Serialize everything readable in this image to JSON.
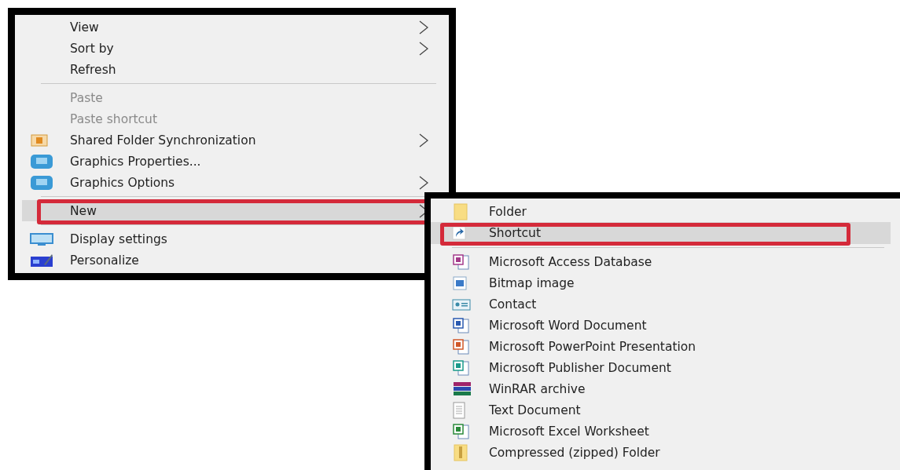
{
  "context_menu": {
    "items": [
      {
        "kind": "item",
        "label": "View",
        "disabled": false,
        "submenu": true,
        "selected": false
      },
      {
        "kind": "item",
        "label": "Sort by",
        "disabled": false,
        "submenu": true,
        "selected": false
      },
      {
        "kind": "item",
        "label": "Refresh",
        "disabled": false,
        "submenu": false,
        "selected": false
      },
      {
        "kind": "separator"
      },
      {
        "kind": "item",
        "label": "Paste",
        "disabled": true,
        "submenu": false,
        "selected": false
      },
      {
        "kind": "item",
        "label": "Paste shortcut",
        "disabled": true,
        "submenu": false,
        "selected": false
      },
      {
        "kind": "item",
        "label": "Shared Folder Synchronization",
        "disabled": false,
        "submenu": true,
        "selected": false
      },
      {
        "kind": "item",
        "label": "Graphics Properties...",
        "disabled": false,
        "submenu": false,
        "selected": false
      },
      {
        "kind": "item",
        "label": "Graphics Options",
        "disabled": false,
        "submenu": true,
        "selected": false
      },
      {
        "kind": "separator"
      },
      {
        "kind": "item",
        "label": "New",
        "disabled": false,
        "submenu": true,
        "selected": true
      },
      {
        "kind": "separator"
      },
      {
        "kind": "item",
        "label": "Display settings",
        "disabled": false,
        "submenu": false,
        "selected": false
      },
      {
        "kind": "item",
        "label": "Personalize",
        "disabled": false,
        "submenu": false,
        "selected": false
      }
    ]
  },
  "new_submenu": {
    "items": [
      {
        "kind": "item",
        "label": "Folder",
        "selected": false
      },
      {
        "kind": "item",
        "label": "Shortcut",
        "selected": true
      },
      {
        "kind": "separator"
      },
      {
        "kind": "item",
        "label": "Microsoft Access Database",
        "selected": false
      },
      {
        "kind": "item",
        "label": "Bitmap image",
        "selected": false
      },
      {
        "kind": "item",
        "label": "Contact",
        "selected": false
      },
      {
        "kind": "item",
        "label": "Microsoft Word Document",
        "selected": false
      },
      {
        "kind": "item",
        "label": "Microsoft PowerPoint Presentation",
        "selected": false
      },
      {
        "kind": "item",
        "label": "Microsoft Publisher Document",
        "selected": false
      },
      {
        "kind": "item",
        "label": "WinRAR archive",
        "selected": false
      },
      {
        "kind": "item",
        "label": "Text Document",
        "selected": false
      },
      {
        "kind": "item",
        "label": "Microsoft Excel Worksheet",
        "selected": false
      },
      {
        "kind": "item",
        "label": "Compressed (zipped) Folder",
        "selected": false
      }
    ]
  }
}
